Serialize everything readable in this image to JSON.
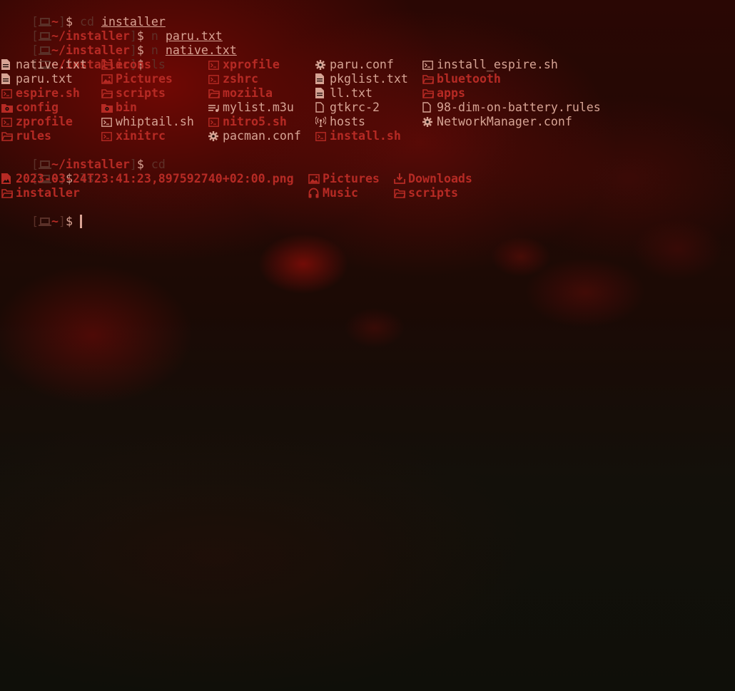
{
  "prompt": {
    "host_icon": "laptop-icon",
    "open_bracket": "[",
    "close_bracket": "]",
    "home_dir": "~",
    "installer_dir": "~/installer",
    "sign": "$"
  },
  "commands": [
    {
      "dir": "~",
      "cmd": "cd",
      "arg": "installer"
    },
    {
      "dir": "~/installer",
      "cmd": "n",
      "arg": "paru.txt"
    },
    {
      "dir": "~/installer",
      "cmd": "n",
      "arg": "native.txt"
    },
    {
      "dir": "~/installer",
      "cmd": "ls",
      "arg": ""
    },
    {
      "dir": "~/installer",
      "cmd": "cd",
      "arg": ""
    },
    {
      "dir": "~",
      "cmd": "ls",
      "arg": ""
    }
  ],
  "installer_listing": [
    [
      "native.txt",
      "icons",
      "xprofile",
      "paru.conf",
      "install_espire.sh"
    ],
    [
      "paru.txt",
      "Pictures",
      "zshrc",
      "pkglist.txt",
      "bluetooth"
    ],
    [
      "espire.sh",
      "scripts",
      "moziila",
      "ll.txt",
      "apps"
    ],
    [
      "config",
      "bin",
      "mylist.m3u",
      "gtkrc-2",
      "98-dim-on-battery.rules"
    ],
    [
      "zprofile",
      "whiptail.sh",
      "nitro5.sh",
      "hosts",
      "NetworkManager.conf"
    ],
    [
      "rules",
      "xinitrc",
      "pacman.conf",
      "install.sh",
      ""
    ]
  ],
  "installer_icons": [
    [
      "text-file-icon",
      "folder-icon",
      "terminal-file-icon",
      "gear-icon",
      "terminal-file-icon"
    ],
    [
      "text-file-icon",
      "image-folder-icon",
      "terminal-file-icon",
      "text-file-icon",
      "folder-icon"
    ],
    [
      "terminal-file-icon",
      "folder-icon",
      "folder-icon",
      "text-file-icon",
      "folder-icon"
    ],
    [
      "config-folder-icon",
      "config-folder-icon",
      "playlist-icon",
      "file-icon",
      "file-icon"
    ],
    [
      "terminal-file-icon",
      "terminal-file-icon",
      "terminal-file-icon",
      "antenna-icon",
      "gear-icon"
    ],
    [
      "folder-icon",
      "terminal-file-icon",
      "gear-icon",
      "terminal-file-icon",
      ""
    ]
  ],
  "home_listing": [
    [
      "2023-03-24T23:41:23,897592740+02:00.png",
      "Pictures",
      "Downloads"
    ],
    [
      "installer",
      "Music",
      "scripts"
    ]
  ],
  "home_icons": [
    [
      "image-file-icon",
      "image-folder-icon",
      "download-folder-icon"
    ],
    [
      "folder-icon",
      "headphones-icon",
      "folder-icon"
    ]
  ],
  "colors": {
    "directory": "#b62a24",
    "plain_text": "#d6a394",
    "dim": "#5a3028"
  }
}
